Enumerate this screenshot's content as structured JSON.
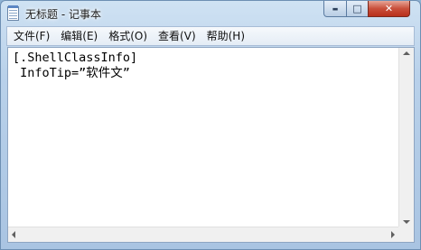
{
  "window": {
    "title": "无标题 - 记事本",
    "controls": {
      "minimize": "▬",
      "maximize": "□",
      "close": "✕"
    }
  },
  "menu": [
    {
      "label": "文件(F)"
    },
    {
      "label": "编辑(E)"
    },
    {
      "label": "格式(O)"
    },
    {
      "label": "查看(V)"
    },
    {
      "label": "帮助(H)"
    }
  ],
  "editor": {
    "line1": "[.ShellClassInfo]",
    "line2": " InfoTip=”软件文”"
  },
  "icons": {
    "app": "notepad-icon",
    "minimize": "minimize-icon",
    "maximize": "maximize-icon",
    "close": "close-icon"
  }
}
